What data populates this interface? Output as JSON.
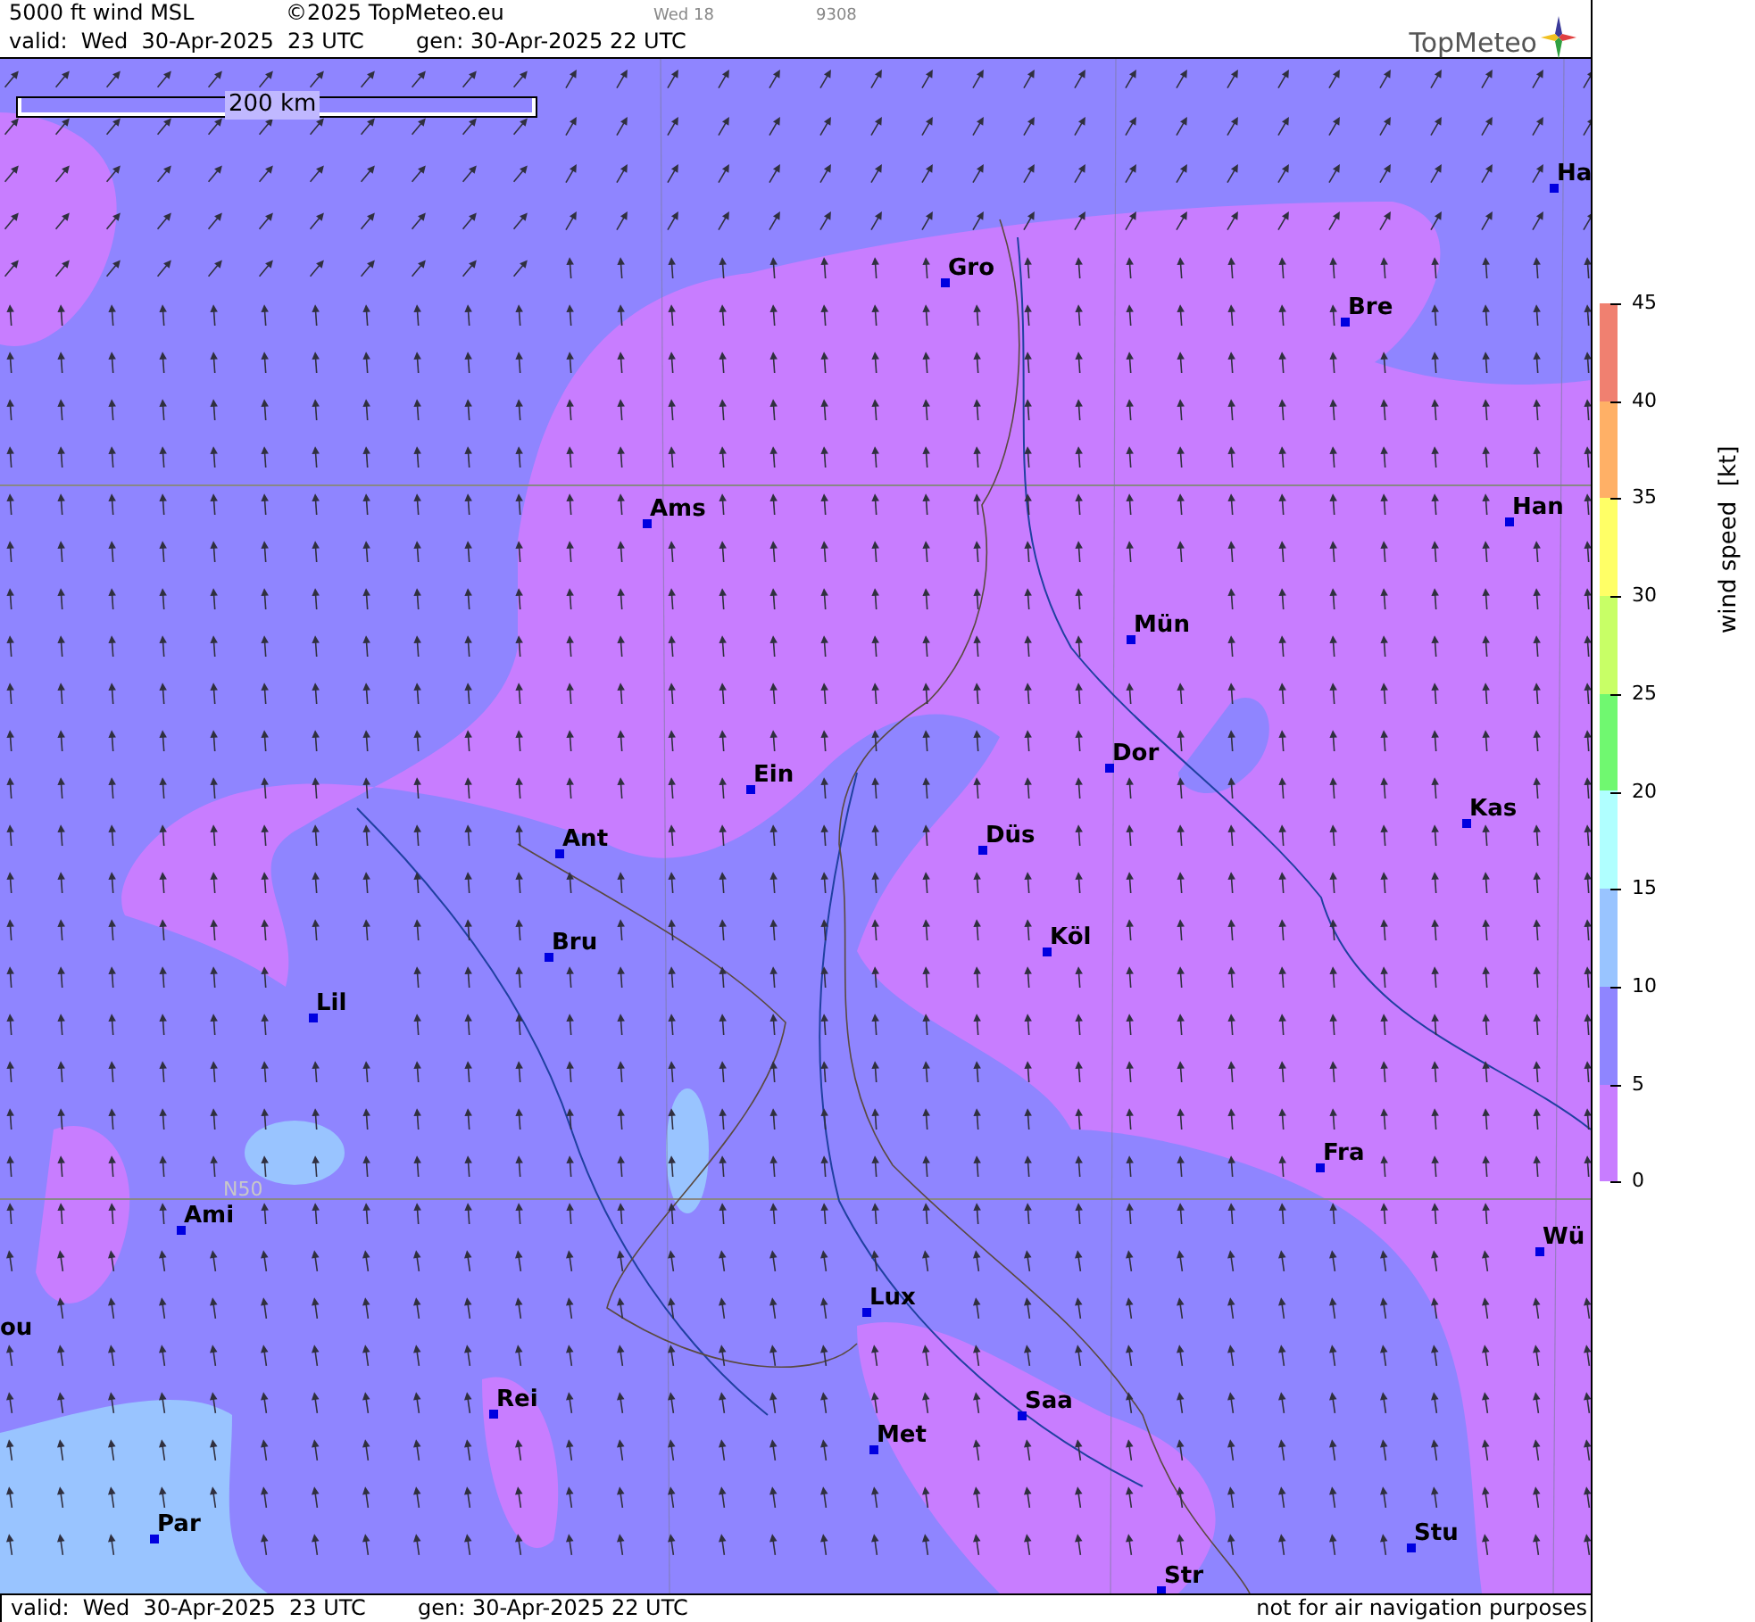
{
  "header": {
    "title": "5000 ft wind MSL",
    "copyright": "©2025 TopMeteo.eu",
    "run_label": "Wed 18",
    "code": "9308",
    "valid": "valid:  Wed  30-Apr-2025  23 UTC",
    "generated": "gen: 30-Apr-2025 22 UTC",
    "logo": "TopMeteo"
  },
  "map": {
    "scale_label": "200 km",
    "latitude_label": "N50",
    "cities": [
      {
        "name": "Ha"
      },
      {
        "name": "Gro"
      },
      {
        "name": "Bre"
      },
      {
        "name": "Ams"
      },
      {
        "name": "Han"
      },
      {
        "name": "Mün"
      },
      {
        "name": "Dor"
      },
      {
        "name": "Ein"
      },
      {
        "name": "Kas"
      },
      {
        "name": "Ant"
      },
      {
        "name": "Düs"
      },
      {
        "name": "Köl"
      },
      {
        "name": "Bru"
      },
      {
        "name": "Lil"
      },
      {
        "name": "Fra"
      },
      {
        "name": "Ami"
      },
      {
        "name": "Wü"
      },
      {
        "name": "ou"
      },
      {
        "name": "Lux"
      },
      {
        "name": "Rei"
      },
      {
        "name": "Saa"
      },
      {
        "name": "Met"
      },
      {
        "name": "Par"
      },
      {
        "name": "Stu"
      },
      {
        "name": "Str"
      }
    ]
  },
  "legend": {
    "title": "wind speed  [kt]",
    "ticks": [
      "45",
      "40",
      "35",
      "30",
      "25",
      "20",
      "15",
      "10",
      "5",
      "0"
    ],
    "bands": [
      {
        "color": "#f08070"
      },
      {
        "color": "#ffb066"
      },
      {
        "color": "#ffff66"
      },
      {
        "color": "#c8ff66"
      },
      {
        "color": "#70f870"
      },
      {
        "color": "#b0ffff"
      },
      {
        "color": "#99c4ff"
      },
      {
        "color": "#8f85ff"
      },
      {
        "color": "#c87dff"
      }
    ]
  },
  "footer": {
    "valid": "valid:  Wed  30-Apr-2025  23 UTC",
    "generated": "gen: 30-Apr-2025 22 UTC",
    "disclaimer": "not for air navigation purposes"
  }
}
